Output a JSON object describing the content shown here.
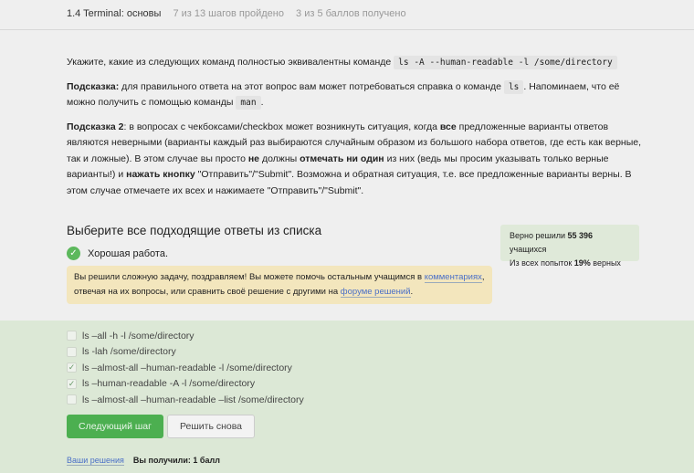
{
  "header": {
    "title": "1.4 Terminal: основы",
    "steps": "7 из 13 шагов пройдено",
    "points": "3 из 5 баллов  получено"
  },
  "question": {
    "prefix": "Укажите, какие из следующих команд полностью эквивалентны команде ",
    "command": "ls -A --human-readable -l /some/directory",
    "hint1_label": "Подсказка:",
    "hint1_a": " для правильного ответа на этот вопрос вам может потребоваться справка о команде ",
    "hint1_cmd": "ls",
    "hint1_b": ". Напоминаем, что её можно получить с помощью команды ",
    "hint1_cmd2": "man",
    "hint1_c": ".",
    "hint2_label": "Подсказка 2",
    "hint2_a": ": в вопросах с чекбоксами/checkbox может возникнуть ситуация, когда ",
    "hint2_b1": "все",
    "hint2_b": " предложенные варианты ответов являются неверными (варианты каждый раз выбираются случайным образом из большого набора ответов, где есть как верные, так и ложные). В этом случае вы просто ",
    "hint2_b2": "не",
    "hint2_c": " должны ",
    "hint2_b3": "отмечать ни один",
    "hint2_d": " из них (ведь мы просим указывать только верные варианты!) и ",
    "hint2_b4": "нажать кнопку",
    "hint2_e": " \"Отправить\"/\"Submit\". Возможна и обратная ситуация, т.е. все предложенные варианты верны. В этом случае отмечаете их всех и нажимаете \"Отправить\"/\"Submit\"."
  },
  "quiz": {
    "title": "Выберите все подходящие ответы из списка",
    "result": "Хорошая работа.",
    "note_a": "Вы решили сложную задачу, поздравляем! Вы можете помочь остальным учащимся в ",
    "note_link1": "комментариях",
    "note_b": ", отвечая на их вопросы, или сравнить своё решение с другими на ",
    "note_link2": "форуме решений",
    "note_c": "."
  },
  "stats": {
    "l1a": "Верно решили ",
    "l1b": "55 396",
    "l1c": " учащихся",
    "l2a": "Из всех попыток ",
    "l2b": "19%",
    "l2c": " верных"
  },
  "options": [
    {
      "label": "ls –all -h -l /some/directory",
      "checked": false
    },
    {
      "label": "ls -lah /some/directory",
      "checked": false
    },
    {
      "label": "ls –almost-all –human-readable -l /some/directory",
      "checked": true
    },
    {
      "label": "ls –human-readable -A  -l /some/directory",
      "checked": true
    },
    {
      "label": "ls –almost-all –human-readable –list /some/directory",
      "checked": false
    }
  ],
  "buttons": {
    "next": "Следующий шаг",
    "again": "Решить снова"
  },
  "footer": {
    "solutions": "Ваши решения",
    "score_label": "Вы получили:",
    "score": "1 балл"
  }
}
